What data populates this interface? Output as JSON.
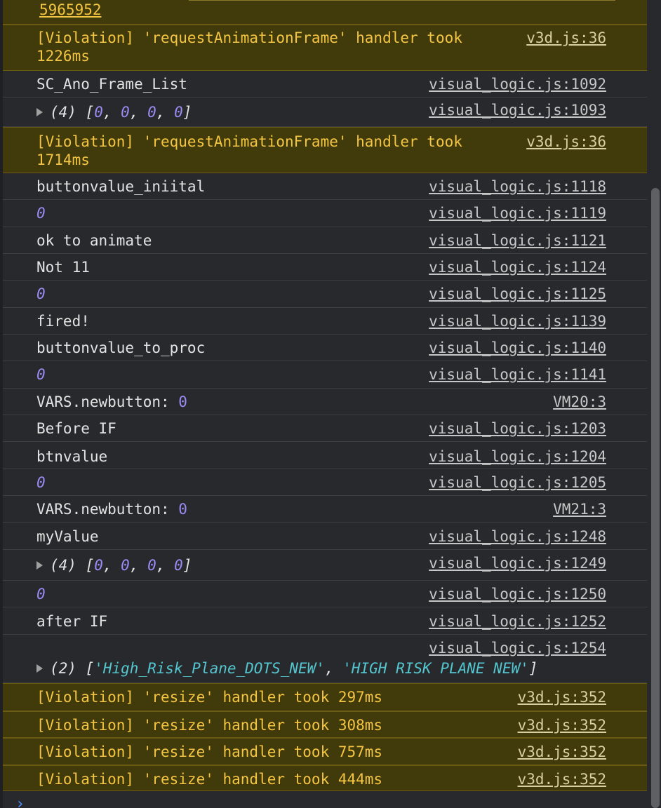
{
  "top_fragment": "5965952",
  "rows": [
    {
      "type": "warn",
      "text": "[Violation] 'requestAnimationFrame' handler took 1226ms",
      "source": "v3d.js:36"
    },
    {
      "type": "log",
      "text": "SC_Ano_Frame_List",
      "source": "visual_logic.js:1092"
    },
    {
      "type": "array",
      "prefix": "(4) [",
      "items": [
        "0",
        "0",
        "0",
        "0"
      ],
      "suffix": "]",
      "source": "visual_logic.js:1093"
    },
    {
      "type": "warn",
      "text": "[Violation] 'requestAnimationFrame' handler took 1714ms",
      "source": "v3d.js:36"
    },
    {
      "type": "log",
      "text": "buttonvalue_iniital",
      "source": "visual_logic.js:1118"
    },
    {
      "type": "number",
      "text": "0",
      "source": "visual_logic.js:1119"
    },
    {
      "type": "log",
      "text": "ok to animate",
      "source": "visual_logic.js:1121"
    },
    {
      "type": "log",
      "text": "Not 11",
      "source": "visual_logic.js:1124"
    },
    {
      "type": "number",
      "text": "0",
      "source": "visual_logic.js:1125"
    },
    {
      "type": "log",
      "text": "fired!",
      "source": "visual_logic.js:1139"
    },
    {
      "type": "log",
      "text": "buttonvalue_to_proc",
      "source": "visual_logic.js:1140"
    },
    {
      "type": "number",
      "text": "0",
      "source": "visual_logic.js:1141"
    },
    {
      "type": "logval",
      "text": "VARS.newbutton: ",
      "value": "0",
      "source": "VM20:3"
    },
    {
      "type": "log",
      "text": "Before IF",
      "source": "visual_logic.js:1203"
    },
    {
      "type": "log",
      "text": "btnvalue",
      "source": "visual_logic.js:1204"
    },
    {
      "type": "number",
      "text": "0",
      "source": "visual_logic.js:1205"
    },
    {
      "type": "logval",
      "text": "VARS.newbutton: ",
      "value": "0",
      "source": "VM21:3"
    },
    {
      "type": "log",
      "text": "myValue",
      "source": "visual_logic.js:1248"
    },
    {
      "type": "array",
      "prefix": "(4) [",
      "items": [
        "0",
        "0",
        "0",
        "0"
      ],
      "suffix": "]",
      "source": "visual_logic.js:1249"
    },
    {
      "type": "number",
      "text": "0",
      "source": "visual_logic.js:1250"
    },
    {
      "type": "log",
      "text": "after IF",
      "source": "visual_logic.js:1252"
    },
    {
      "type": "strarray",
      "prefix": "(2) [",
      "items": [
        "'High_Risk_Plane_DOTS_NEW'",
        "'HIGH RISK PLANE NEW'"
      ],
      "suffix": "]",
      "source": "visual_logic.js:1254"
    },
    {
      "type": "warn",
      "text": "[Violation] 'resize' handler took 297ms",
      "source": "v3d.js:352"
    },
    {
      "type": "warn",
      "text": "[Violation] 'resize' handler took 308ms",
      "source": "v3d.js:352"
    },
    {
      "type": "warn",
      "text": "[Violation] 'resize' handler took 757ms",
      "source": "v3d.js:352"
    },
    {
      "type": "warn",
      "text": "[Violation] 'resize' handler took 444ms",
      "source": "v3d.js:352"
    }
  ],
  "prompt_symbol": "›",
  "colors": {
    "background": "#28292c",
    "warning_bg": "#413a0b",
    "warning_text": "#f4c542",
    "number": "#9a8cf5",
    "string": "#53c6cf",
    "prompt": "#4d8dff"
  }
}
